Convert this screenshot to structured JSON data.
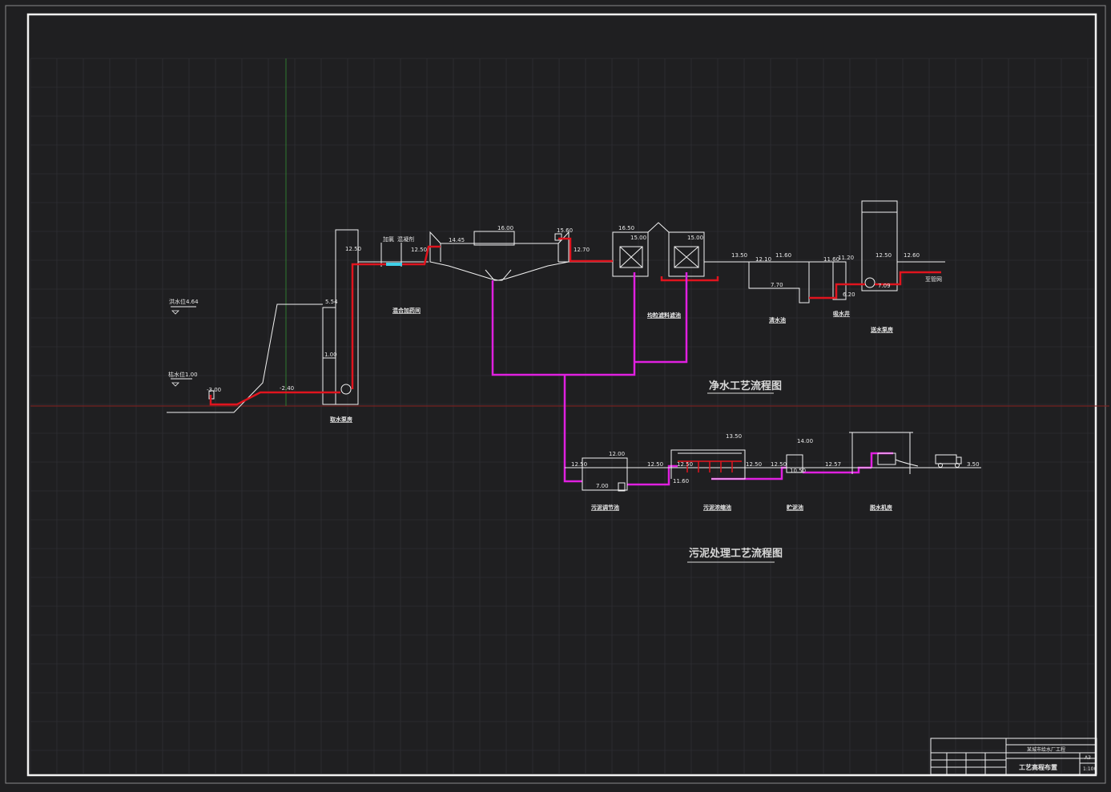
{
  "colors": {
    "background": "#1f1f21",
    "grid": "#34343a",
    "outline": "#f2f2f2",
    "main_flow": "#e0141e",
    "sludge_flow": "#e020e0",
    "axis_red": "#8a2020",
    "axis_green": "#2f7a2f",
    "chem": "#3fd0e8"
  },
  "elevations": {
    "water_level_high": "洪水位4.64",
    "water_level_low": "枯水位1.00",
    "intake_in": "-3.00",
    "intake_pipe": "-2.40",
    "pump_top": "5.54",
    "pump_mid": "1.00",
    "pump_riser": "12.50",
    "mixer": "12.50",
    "basin_inlet": "14.45",
    "basin_top": "16.00",
    "basin_out": "15.60",
    "basin_channel": "12.70",
    "filter_top": "16.50",
    "filter_a": "15.00",
    "filter_b": "15.00",
    "filter_out": "13.50",
    "tank_top": "12.10",
    "tank_top2": "11.60",
    "tank_bottom": "7.70",
    "well_top": "11.60",
    "well_mid": "11.20",
    "well_bottom": "6.20",
    "lift_top": "12.50",
    "lift_out": "12.60",
    "lift_pump": "7.09",
    "sludge_in": "12.50",
    "sludge_tank_top": "12.00",
    "sludge_tank_bot": "7.00",
    "sludge_pipe": "12.50",
    "thick_top": "13.50",
    "thick_in": "12.50",
    "thick_bot": "11.60",
    "thick_out": "12.50",
    "storage_top": "14.00",
    "storage_bot": "10.50",
    "storage_out": "12.57",
    "dewater_out": "3.50"
  },
  "labels": {
    "dosing_a": "加氯",
    "dosing_b": "混凝剂",
    "mixer": "混合加药间",
    "filter": "均粒滤料滤池",
    "clear_tank": "清水池",
    "suction_well": "吸水井",
    "lift_pump": "送水泵房",
    "to_network": "至管网",
    "intake_pump": "取水泵房",
    "sludge_balance": "污泥调节池",
    "sludge_thickener": "污泥浓缩池",
    "sludge_storage": "贮泥池",
    "dewater": "脱水机房"
  },
  "titles": {
    "water": "净水工艺流程图",
    "sludge": "污泥处理工艺流程图"
  },
  "title_block": {
    "project": "某城市给水厂工程",
    "drawing": "工艺高程布置",
    "size": "A3",
    "scale": "1:100"
  }
}
